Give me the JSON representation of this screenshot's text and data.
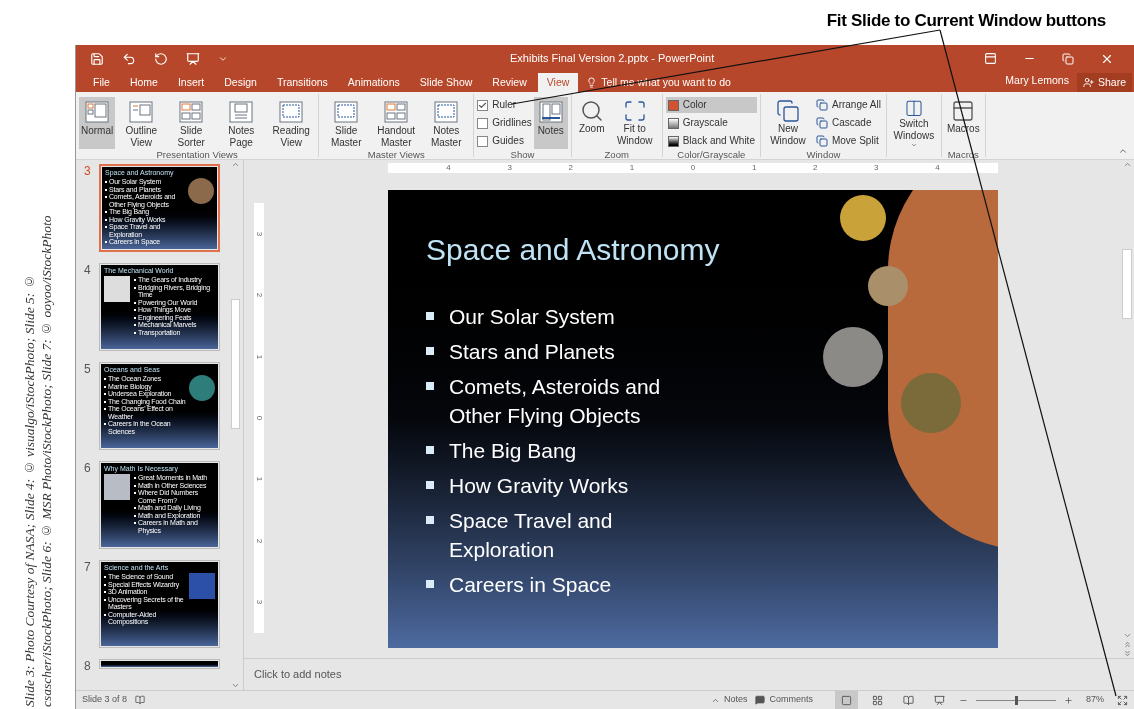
{
  "callout": {
    "text": "Fit Slide to Current Window buttons"
  },
  "credit": {
    "text": "Slide 3: Photo Courtesy of NASA; Slide 4: © visualgo/iStockPhoto; Slide 5: © csascher/iStockPhoto; Slide 6: © MSR Photo/iStockPhoto; Slide 7: © ooyoo/iStockPhoto"
  },
  "window": {
    "title": "Exhibits Final Version 2.pptx - PowerPoint"
  },
  "tabs": [
    {
      "label": "File",
      "selected": false
    },
    {
      "label": "Home",
      "selected": false
    },
    {
      "label": "Insert",
      "selected": false
    },
    {
      "label": "Design",
      "selected": false
    },
    {
      "label": "Transitions",
      "selected": false
    },
    {
      "label": "Animations",
      "selected": false
    },
    {
      "label": "Slide Show",
      "selected": false
    },
    {
      "label": "Review",
      "selected": false
    },
    {
      "label": "View",
      "selected": true
    }
  ],
  "tell_me": {
    "placeholder": "Tell me what you want to do"
  },
  "user": {
    "name": "Mary Lemons"
  },
  "share": {
    "label": "Share"
  },
  "ribbon": {
    "groups": [
      {
        "label": "Presentation Views",
        "items": [
          {
            "kind": "big",
            "label": "Normal",
            "selected": true
          },
          {
            "kind": "big",
            "label": "Outline View",
            "selected": false
          },
          {
            "kind": "big",
            "label": "Slide Sorter",
            "selected": false
          },
          {
            "kind": "big",
            "label": "Notes Page",
            "selected": false
          },
          {
            "kind": "big",
            "label": "Reading View",
            "selected": false
          }
        ]
      },
      {
        "label": "Master Views",
        "items": [
          {
            "kind": "big",
            "label": "Slide Master",
            "selected": false
          },
          {
            "kind": "big",
            "label": "Handout Master",
            "selected": false
          },
          {
            "kind": "big",
            "label": "Notes Master",
            "selected": false
          }
        ]
      },
      {
        "label": "Show",
        "items": [
          {
            "kind": "check",
            "label": "Ruler",
            "checked": true
          },
          {
            "kind": "check",
            "label": "Gridlines",
            "checked": false
          },
          {
            "kind": "check",
            "label": "Guides",
            "checked": false
          },
          {
            "kind": "big",
            "label": "Notes",
            "selected": true
          }
        ]
      },
      {
        "label": "Zoom",
        "items": [
          {
            "kind": "big",
            "label": "Zoom",
            "selected": false
          },
          {
            "kind": "big",
            "label": "Fit to Window",
            "selected": false
          }
        ]
      },
      {
        "label": "Color/Grayscale",
        "items": [
          {
            "kind": "small",
            "label": "Color",
            "selected": true
          },
          {
            "kind": "small",
            "label": "Grayscale",
            "selected": false
          },
          {
            "kind": "small",
            "label": "Black and White",
            "selected": false
          }
        ]
      },
      {
        "label": "Window",
        "items": [
          {
            "kind": "big",
            "label": "New Window",
            "selected": false
          },
          {
            "kind": "small",
            "label": "Arrange All",
            "selected": false
          },
          {
            "kind": "small",
            "label": "Cascade",
            "selected": false
          },
          {
            "kind": "small",
            "label": "Move Split",
            "selected": false
          }
        ]
      },
      {
        "items": [
          {
            "kind": "big",
            "label": "Switch Windows",
            "selected": false,
            "dropdown": true
          }
        ]
      },
      {
        "label": "Macros",
        "items": [
          {
            "kind": "big",
            "label": "Macros",
            "selected": false
          }
        ]
      }
    ]
  },
  "thumbnails": [
    {
      "number": "3",
      "selected": true,
      "title": "Space and Astronomy",
      "kind": "imageright",
      "bullets": [
        "Our Solar System",
        "Stars and Planets",
        "Comets, Asteroids and Other Flying Objects",
        "The Big Bang",
        "How Gravity Works",
        "Space Travel and Exploration",
        "Careers in Space"
      ]
    },
    {
      "number": "4",
      "selected": false,
      "title": "The Mechanical World",
      "kind": "imageleft",
      "bullets": [
        "The Gears of Industry",
        "Bridging Rivers, Bridging Time",
        "Powering Our World",
        "How Things Move",
        "Engineering Feats",
        "Mechanical Marvels",
        "Transportation"
      ]
    },
    {
      "number": "5",
      "selected": false,
      "title": "Oceans and Seas",
      "kind": "imageright",
      "bullets": [
        "The Ocean Zones",
        "Marine Biology",
        "Undersea Exploration",
        "The Changing Food Chain",
        "The Oceans' Effect on Weather",
        "Careers in the Ocean Sciences"
      ]
    },
    {
      "number": "6",
      "selected": false,
      "title": "Why Math Is Necessary",
      "kind": "imageleft",
      "bullets": [
        "Great Moments in Math",
        "Math in Other Sciences",
        "Where Did Numbers Come From?",
        "Math and Daily Living",
        "Math and Exploration",
        "Careers in Math and Physics"
      ]
    },
    {
      "number": "7",
      "selected": false,
      "title": "Science and the Arts",
      "kind": "imageright",
      "bullets": [
        "The Science of Sound",
        "Special Effects Wizardry",
        "3D Animation",
        "Uncovering Secrets of the Masters",
        "Computer-Aided Compositions"
      ]
    },
    {
      "number": "8",
      "selected": false,
      "kind": "partial"
    }
  ],
  "ruler": {
    "horizontal": [
      "4",
      "3",
      "2",
      "1",
      "0",
      "1",
      "2",
      "3",
      "4"
    ],
    "vertical": [
      "3",
      "2",
      "1",
      "0",
      "1",
      "2",
      "3"
    ]
  },
  "slide": {
    "title": "Space and Astronomy",
    "bullets": [
      "Our Solar System",
      "Stars and Planets",
      "Comets, Asteroids and Other Flying Objects",
      "The Big Bang",
      "How Gravity Works",
      "Space Travel and Exploration",
      "Careers in Space"
    ]
  },
  "notes": {
    "placeholder": "Click to add notes"
  },
  "status_bar": {
    "slide_info": "Slide 3 of 8",
    "notes": "Notes",
    "comments": "Comments",
    "views": [
      {
        "selected": true
      },
      {
        "selected": false
      },
      {
        "selected": false
      },
      {
        "selected": false
      }
    ],
    "zoom": {
      "level": 0.5,
      "reading": "87%"
    }
  }
}
